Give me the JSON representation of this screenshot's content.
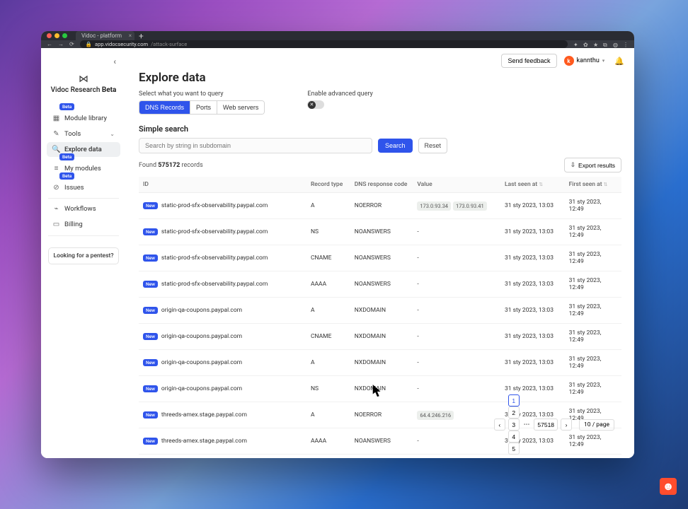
{
  "browser": {
    "tab_title": "Vidoc - platform",
    "url_host": "app.vidocsecurity.com",
    "url_path": "/attack-surface"
  },
  "sidebar": {
    "brand": "Vidoc Research",
    "brand_suffix": "Beta",
    "items": [
      {
        "icon": "grid",
        "label": "Module library",
        "beta": true,
        "active": false
      },
      {
        "icon": "wrench",
        "label": "Tools",
        "beta": false,
        "active": false,
        "chev": true
      },
      {
        "icon": "search",
        "label": "Explore data",
        "beta": false,
        "active": true
      },
      {
        "icon": "database",
        "label": "My modules",
        "beta": true,
        "active": false
      },
      {
        "icon": "bug",
        "label": "Issues",
        "beta": true,
        "active": false
      },
      {
        "icon": "flow",
        "label": "Workflows",
        "beta": false,
        "active": false
      },
      {
        "icon": "card",
        "label": "Billing",
        "beta": false,
        "active": false
      }
    ],
    "pentest": "Looking for a pentest?"
  },
  "header": {
    "feedback": "Send feedback",
    "username": "kannthu"
  },
  "page": {
    "title": "Explore data",
    "select_label": "Select what you want to query",
    "segments": [
      "DNS Records",
      "Ports",
      "Web servers"
    ],
    "adv_label": "Enable advanced query",
    "simple_search": "Simple search",
    "search_placeholder": "Search by string in subdomain",
    "search_btn": "Search",
    "reset_btn": "Reset",
    "found_prefix": "Found ",
    "found_count": "575172",
    "found_suffix": " records",
    "export": "Export results",
    "columns": [
      "ID",
      "Record type",
      "DNS response code",
      "Value",
      "Last seen at",
      "First seen at"
    ],
    "rows": [
      {
        "id": "static-prod-sfx-observability.paypal.com",
        "rt": "A",
        "code": "NOERROR",
        "values": [
          "173.0.93.34",
          "173.0.93.41"
        ],
        "ls": "31 sty 2023, 13:03",
        "fs": "31 sty 2023, 12:49"
      },
      {
        "id": "static-prod-sfx-observability.paypal.com",
        "rt": "NS",
        "code": "NOANSWERS",
        "values": [],
        "ls": "31 sty 2023, 13:03",
        "fs": "31 sty 2023, 12:49"
      },
      {
        "id": "static-prod-sfx-observability.paypal.com",
        "rt": "CNAME",
        "code": "NOANSWERS",
        "values": [],
        "ls": "31 sty 2023, 13:03",
        "fs": "31 sty 2023, 12:49"
      },
      {
        "id": "static-prod-sfx-observability.paypal.com",
        "rt": "AAAA",
        "code": "NOANSWERS",
        "values": [],
        "ls": "31 sty 2023, 13:03",
        "fs": "31 sty 2023, 12:49"
      },
      {
        "id": "origin-qa-coupons.paypal.com",
        "rt": "A",
        "code": "NXDOMAIN",
        "values": [],
        "ls": "31 sty 2023, 13:03",
        "fs": "31 sty 2023, 12:49"
      },
      {
        "id": "origin-qa-coupons.paypal.com",
        "rt": "CNAME",
        "code": "NXDOMAIN",
        "values": [],
        "ls": "31 sty 2023, 13:03",
        "fs": "31 sty 2023, 12:49"
      },
      {
        "id": "origin-qa-coupons.paypal.com",
        "rt": "A",
        "code": "NXDOMAIN",
        "values": [],
        "ls": "31 sty 2023, 13:03",
        "fs": "31 sty 2023, 12:49"
      },
      {
        "id": "origin-qa-coupons.paypal.com",
        "rt": "NS",
        "code": "NXDOMAIN",
        "values": [],
        "ls": "31 sty 2023, 13:03",
        "fs": "31 sty 2023, 12:49"
      },
      {
        "id": "threeds-amex.stage.paypal.com",
        "rt": "A",
        "code": "NOERROR",
        "values": [
          "64.4.246.216"
        ],
        "ls": "31 sty 2023, 13:03",
        "fs": "31 sty 2023, 12:49"
      },
      {
        "id": "threeds-amex.stage.paypal.com",
        "rt": "AAAA",
        "code": "NOANSWERS",
        "values": [],
        "ls": "31 sty 2023, 13:03",
        "fs": "31 sty 2023, 12:49"
      }
    ],
    "new_label": "New",
    "pager": {
      "pages": [
        "1",
        "2",
        "3",
        "4",
        "5"
      ],
      "ellipsis": "•••",
      "last": "57518",
      "size": "10 / page"
    }
  }
}
